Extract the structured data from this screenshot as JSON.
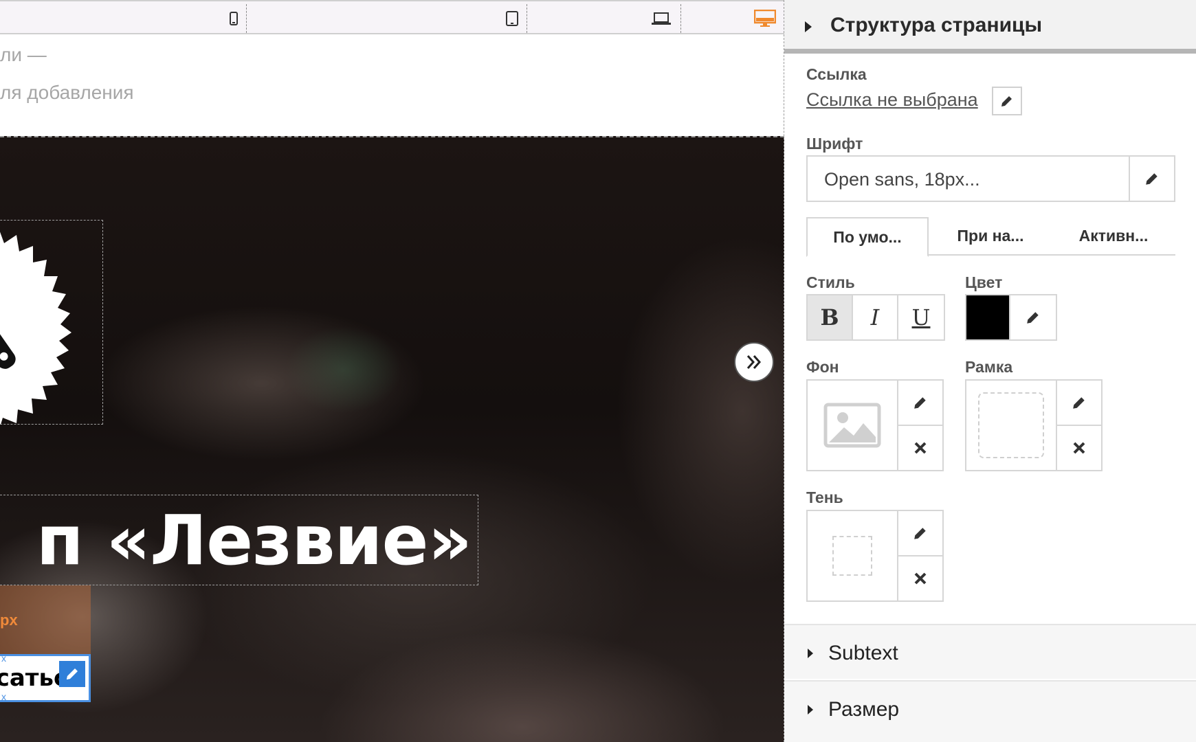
{
  "canvas": {
    "faded_text": [
      "ли —",
      "ля добавления"
    ],
    "hero_title": "п «Лезвие»",
    "size_label": "px",
    "button_text": "саться",
    "handle_mark": "x"
  },
  "device_bar": {
    "icons": [
      "phone-icon",
      "tablet-icon",
      "laptop-icon",
      "desktop-icon"
    ],
    "active": "desktop-icon",
    "active_color": "#f0892d"
  },
  "panel": {
    "header_title": "Структура страницы",
    "link": {
      "label": "Ссылка",
      "value": "Ссылка не выбрана"
    },
    "font": {
      "label": "Шрифт",
      "value": "Open sans, 18px..."
    },
    "state_tabs": [
      {
        "label": "По умо...",
        "active": true
      },
      {
        "label": "При на...",
        "active": false
      },
      {
        "label": "Активн...",
        "active": false
      }
    ],
    "style": {
      "label": "Стиль",
      "bold": "B",
      "italic": "I",
      "underline": "U",
      "active": "bold"
    },
    "color": {
      "label": "Цвет",
      "value": "#000000"
    },
    "background": {
      "label": "Фон"
    },
    "border": {
      "label": "Рамка"
    },
    "shadow": {
      "label": "Тень"
    },
    "sections": [
      "Subtext",
      "Размер"
    ]
  }
}
